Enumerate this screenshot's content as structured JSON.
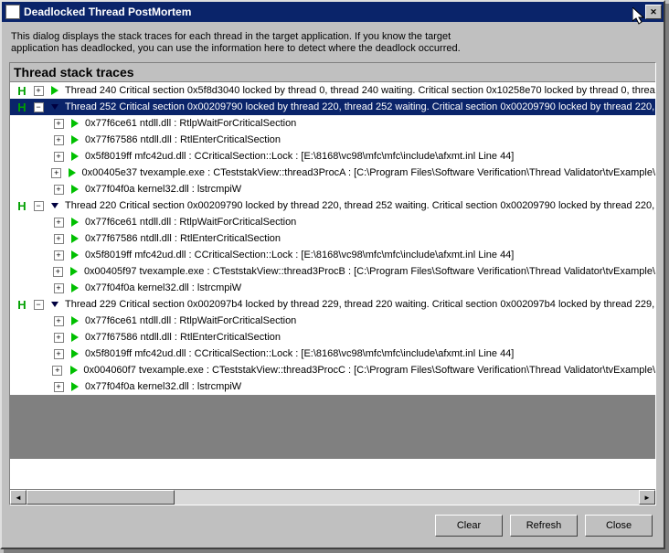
{
  "window": {
    "title": "Deadlocked Thread PostMortem",
    "description_line1": "This dialog displays the stack traces for each thread in the target application. If you know the target",
    "description_line2": "application has deadlocked, you can use the information here to detect where the deadlock occurred."
  },
  "panel": {
    "title": "Thread stack traces"
  },
  "threads": [
    {
      "header": "Thread 240  Critical section 0x5f8d3040 locked by thread 0, thread 240 waiting. Critical section 0x10258e70 locked by thread 0, threa",
      "expanded": false,
      "selected": false,
      "frames": []
    },
    {
      "header": "Thread 252  Critical section 0x00209790 locked by thread 220, thread 252 waiting. Critical section 0x00209790 locked by thread 220,",
      "expanded": true,
      "selected": true,
      "frames": [
        "0x77f6ce61 ntdll.dll : RtlpWaitForCriticalSection",
        "0x77f67586 ntdll.dll : RtlEnterCriticalSection",
        "0x5f8019ff mfc42ud.dll : CCriticalSection::Lock : [E:\\8168\\vc98\\mfc\\mfc\\include\\afxmt.inl Line 44]",
        "0x00405e37 tvexample.exe : CTeststakView::thread3ProcA : [C:\\Program Files\\Software Verification\\Thread Validator\\tvExample\\",
        "0x77f04f0a kernel32.dll : lstrcmpiW"
      ]
    },
    {
      "header": "Thread 220  Critical section 0x00209790 locked by thread 220, thread 252 waiting. Critical section 0x00209790 locked by thread 220,",
      "expanded": true,
      "selected": false,
      "frames": [
        "0x77f6ce61 ntdll.dll : RtlpWaitForCriticalSection",
        "0x77f67586 ntdll.dll : RtlEnterCriticalSection",
        "0x5f8019ff mfc42ud.dll : CCriticalSection::Lock : [E:\\8168\\vc98\\mfc\\mfc\\include\\afxmt.inl Line 44]",
        "0x00405f97 tvexample.exe : CTeststakView::thread3ProcB : [C:\\Program Files\\Software Verification\\Thread Validator\\tvExample\\",
        "0x77f04f0a kernel32.dll : lstrcmpiW"
      ]
    },
    {
      "header": "Thread 229  Critical section 0x002097b4 locked by thread 229, thread 220 waiting. Critical section 0x002097b4 locked by thread 229,",
      "expanded": true,
      "selected": false,
      "frames": [
        "0x77f6ce61 ntdll.dll : RtlpWaitForCriticalSection",
        "0x77f67586 ntdll.dll : RtlEnterCriticalSection",
        "0x5f8019ff mfc42ud.dll : CCriticalSection::Lock : [E:\\8168\\vc98\\mfc\\mfc\\include\\afxmt.inl Line 44]",
        "0x004060f7 tvexample.exe : CTeststakView::thread3ProcC : [C:\\Program Files\\Software Verification\\Thread Validator\\tvExample\\",
        "0x77f04f0a kernel32.dll : lstrcmpiW"
      ]
    }
  ],
  "buttons": {
    "clear": "Clear",
    "refresh": "Refresh",
    "close": "Close"
  }
}
